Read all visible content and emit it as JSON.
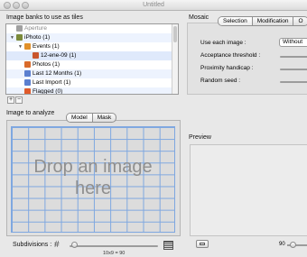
{
  "window": {
    "title": "Untitled"
  },
  "banks": {
    "label": "Image banks to use as tiles",
    "items": [
      {
        "label": "Aperture",
        "level": 0,
        "expander": "",
        "icon_color": "#a0a0a0",
        "dim": true
      },
      {
        "label": "iPhoto (1)",
        "level": 0,
        "expander": "▼",
        "icon_color": "#7b8a3a",
        "dim": false
      },
      {
        "label": "Events (1)",
        "level": 1,
        "expander": "▼",
        "icon_color": "#e0902a",
        "dim": false
      },
      {
        "label": "12-ene-09 (1)",
        "level": 2,
        "expander": "",
        "icon_color": "#c9562c",
        "dim": false
      },
      {
        "label": "Photos (1)",
        "level": 1,
        "expander": "",
        "icon_color": "#d96b2b",
        "dim": false
      },
      {
        "label": "Last 12 Months (1)",
        "level": 1,
        "expander": "",
        "icon_color": "#5b7fcf",
        "dim": false
      },
      {
        "label": "Last Import (1)",
        "level": 1,
        "expander": "",
        "icon_color": "#5b7fcf",
        "dim": false
      },
      {
        "label": "Flagged (0)",
        "level": 1,
        "expander": "",
        "icon_color": "#e05a2a",
        "dim": false
      }
    ],
    "add_label": "+",
    "remove_label": "−"
  },
  "mosaic": {
    "label": "Mosaic",
    "tabs": [
      "Selection",
      "Modification",
      "O"
    ],
    "active_tab": "Selection",
    "use_each_image_label": "Use each image :",
    "use_each_image_value": "Without",
    "acceptance_threshold_label": "Acceptance threshold :",
    "acceptance_threshold_level": 0.1,
    "proximity_handicap_label": "Proximity handicap :",
    "proximity_handicap_level": 0.1,
    "random_seed_label": "Random seed :",
    "random_seed_level": 0.1
  },
  "analyze": {
    "label": "Image to analyze",
    "tabs": [
      "Model",
      "Mask"
    ],
    "active_tab": "Model",
    "drop_line1": "Drop an image",
    "drop_line2": "here",
    "subdivisions_label": "Subdivisions :",
    "subdivisions_value": "10x9 = 90",
    "subdivisions_level": 0.05
  },
  "preview": {
    "label": "Preview",
    "zoom_value": "90"
  },
  "colors": {
    "grid_line": "#7ea7e0",
    "selection": "#dfe9fb",
    "drop_text": "#8f8f8f"
  }
}
